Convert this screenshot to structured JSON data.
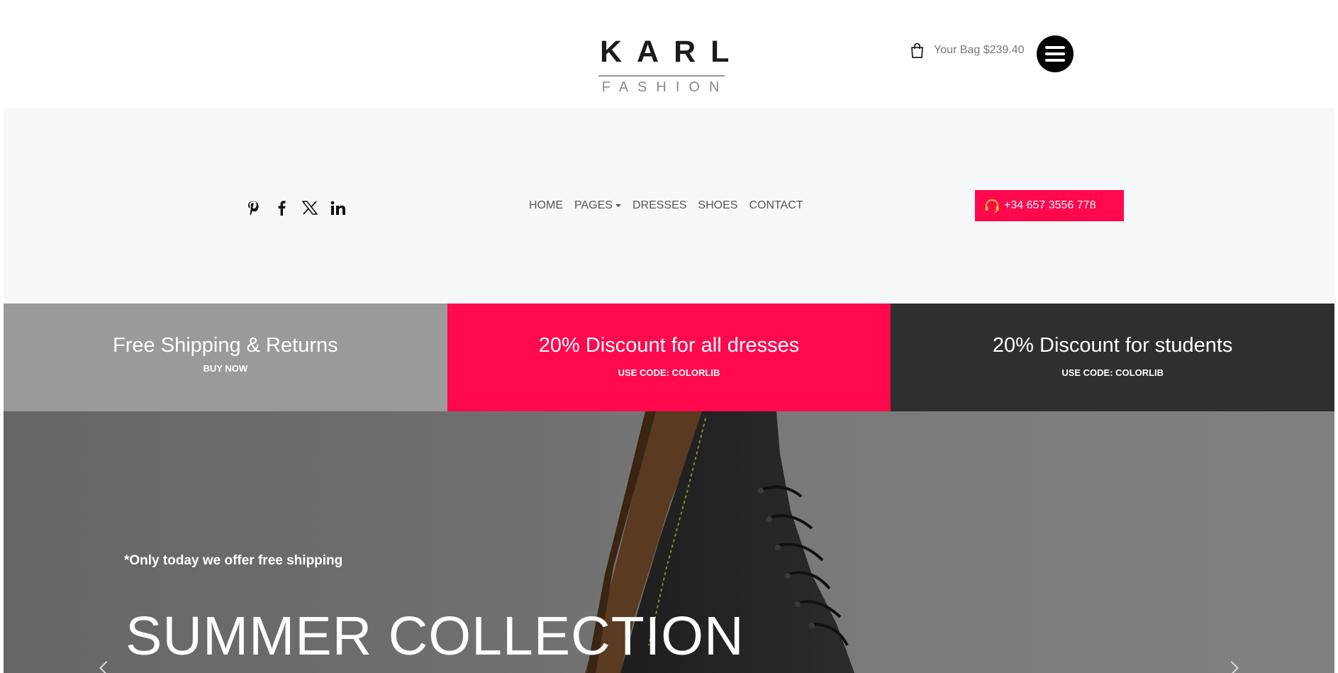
{
  "header": {
    "logo_main": "KARL",
    "logo_sub": "FASHION",
    "bag_label": "Your Bag $239.40",
    "bag_icon": "shopping-bag-icon",
    "menu_icon": "hamburger-menu-icon"
  },
  "nav": {
    "social": [
      {
        "name": "pinterest-icon"
      },
      {
        "name": "facebook-icon"
      },
      {
        "name": "x-twitter-icon"
      },
      {
        "name": "linkedin-icon"
      }
    ],
    "items": [
      {
        "label": "HOME"
      },
      {
        "label": "PAGES",
        "dropdown": true
      },
      {
        "label": "DRESSES"
      },
      {
        "label": "SHOES"
      },
      {
        "label": "CONTACT"
      }
    ],
    "phone": {
      "label": "+34 657 3556 778",
      "icon": "headset-icon",
      "color": "#ff084e"
    }
  },
  "promos": [
    {
      "title": "Free Shipping & Returns",
      "sub": "BUY NOW",
      "color": "#9a999b"
    },
    {
      "title": "20% Discount for all dresses",
      "sub": "USE CODE: Colorlib",
      "color": "#ff084e"
    },
    {
      "title": "20% Discount for students",
      "sub": "USE CODE: Colorlib",
      "color": "#2f2f2f"
    }
  ],
  "hero": {
    "note": "*Only today we offer free shipping",
    "title": "SUMMER COLLECTION",
    "image": "black-boot-image"
  }
}
